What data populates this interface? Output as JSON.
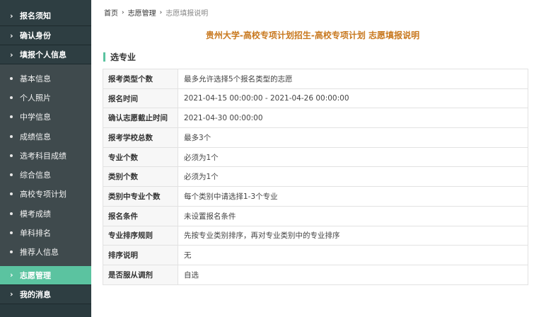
{
  "sidebar": {
    "top_items": [
      {
        "label": "报名须知"
      },
      {
        "label": "确认身份"
      },
      {
        "label": "填报个人信息"
      }
    ],
    "sub_items": [
      {
        "label": "基本信息"
      },
      {
        "label": "个人照片"
      },
      {
        "label": "中学信息"
      },
      {
        "label": "成绩信息"
      },
      {
        "label": "选考科目成绩"
      },
      {
        "label": "综合信息"
      },
      {
        "label": "高校专项计划"
      },
      {
        "label": "模考成绩"
      },
      {
        "label": "单科排名"
      },
      {
        "label": "推荐人信息"
      }
    ],
    "bottom_items": [
      {
        "label": "志愿管理",
        "active": true
      },
      {
        "label": "我的消息"
      }
    ],
    "active_color": "#5bc3a0"
  },
  "breadcrumb": {
    "home": "首页",
    "section": "志愿管理",
    "current": "志愿填报说明"
  },
  "page_title": "贵州大学-高校专项计划招生-高校专项计划 志愿填报说明",
  "section_title": "选专业",
  "info_rows": [
    {
      "key": "报考类型个数",
      "value": "最多允许选择5个报名类型的志愿"
    },
    {
      "key": "报名时间",
      "value": "2021-04-15 00:00:00 - 2021-04-26 00:00:00"
    },
    {
      "key": "确认志愿截止时间",
      "value": "2021-04-30 00:00:00"
    },
    {
      "key": "报考学校总数",
      "value": "最多3个"
    },
    {
      "key": "专业个数",
      "value": "必须为1个"
    },
    {
      "key": "类别个数",
      "value": "必须为1个"
    },
    {
      "key": "类别中专业个数",
      "value": "每个类别中请选择1-3个专业"
    },
    {
      "key": "报名条件",
      "value": "未设置报名条件"
    },
    {
      "key": "专业排序规则",
      "value": "先按专业类别排序，再对专业类别中的专业排序"
    },
    {
      "key": "排序说明",
      "value": "无"
    },
    {
      "key": "是否服从调剂",
      "value": "自选"
    }
  ],
  "colors": {
    "title": "#c8781e",
    "accent": "#5bc3a0",
    "sidebar_bg": "#2a3a3e"
  }
}
